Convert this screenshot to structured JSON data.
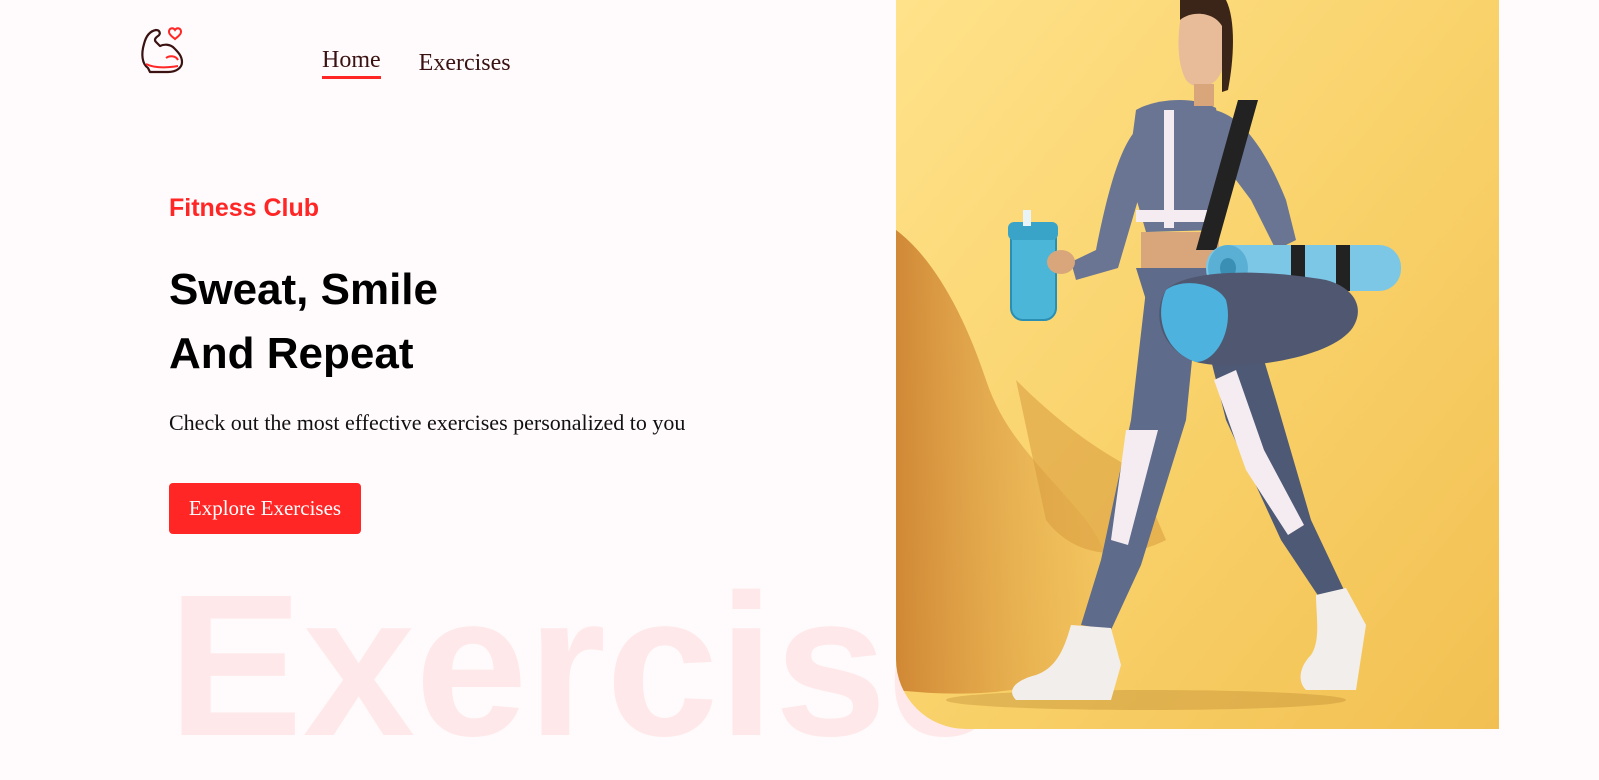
{
  "nav": {
    "home": "Home",
    "exercises": "Exercises"
  },
  "hero": {
    "kicker": "Fitness Club",
    "headline_line1": "Sweat, Smile",
    "headline_line2": "And Repeat",
    "subtext": "Check out the most effective exercises personalized to you",
    "cta": "Explore Exercises"
  },
  "watermark": "Exercise",
  "colors": {
    "accent": "#FF2625",
    "background": "#FFFAFB",
    "banner_bg": "#F9D26B"
  },
  "icons": {
    "logo": "flexed-arm-heart-icon"
  }
}
